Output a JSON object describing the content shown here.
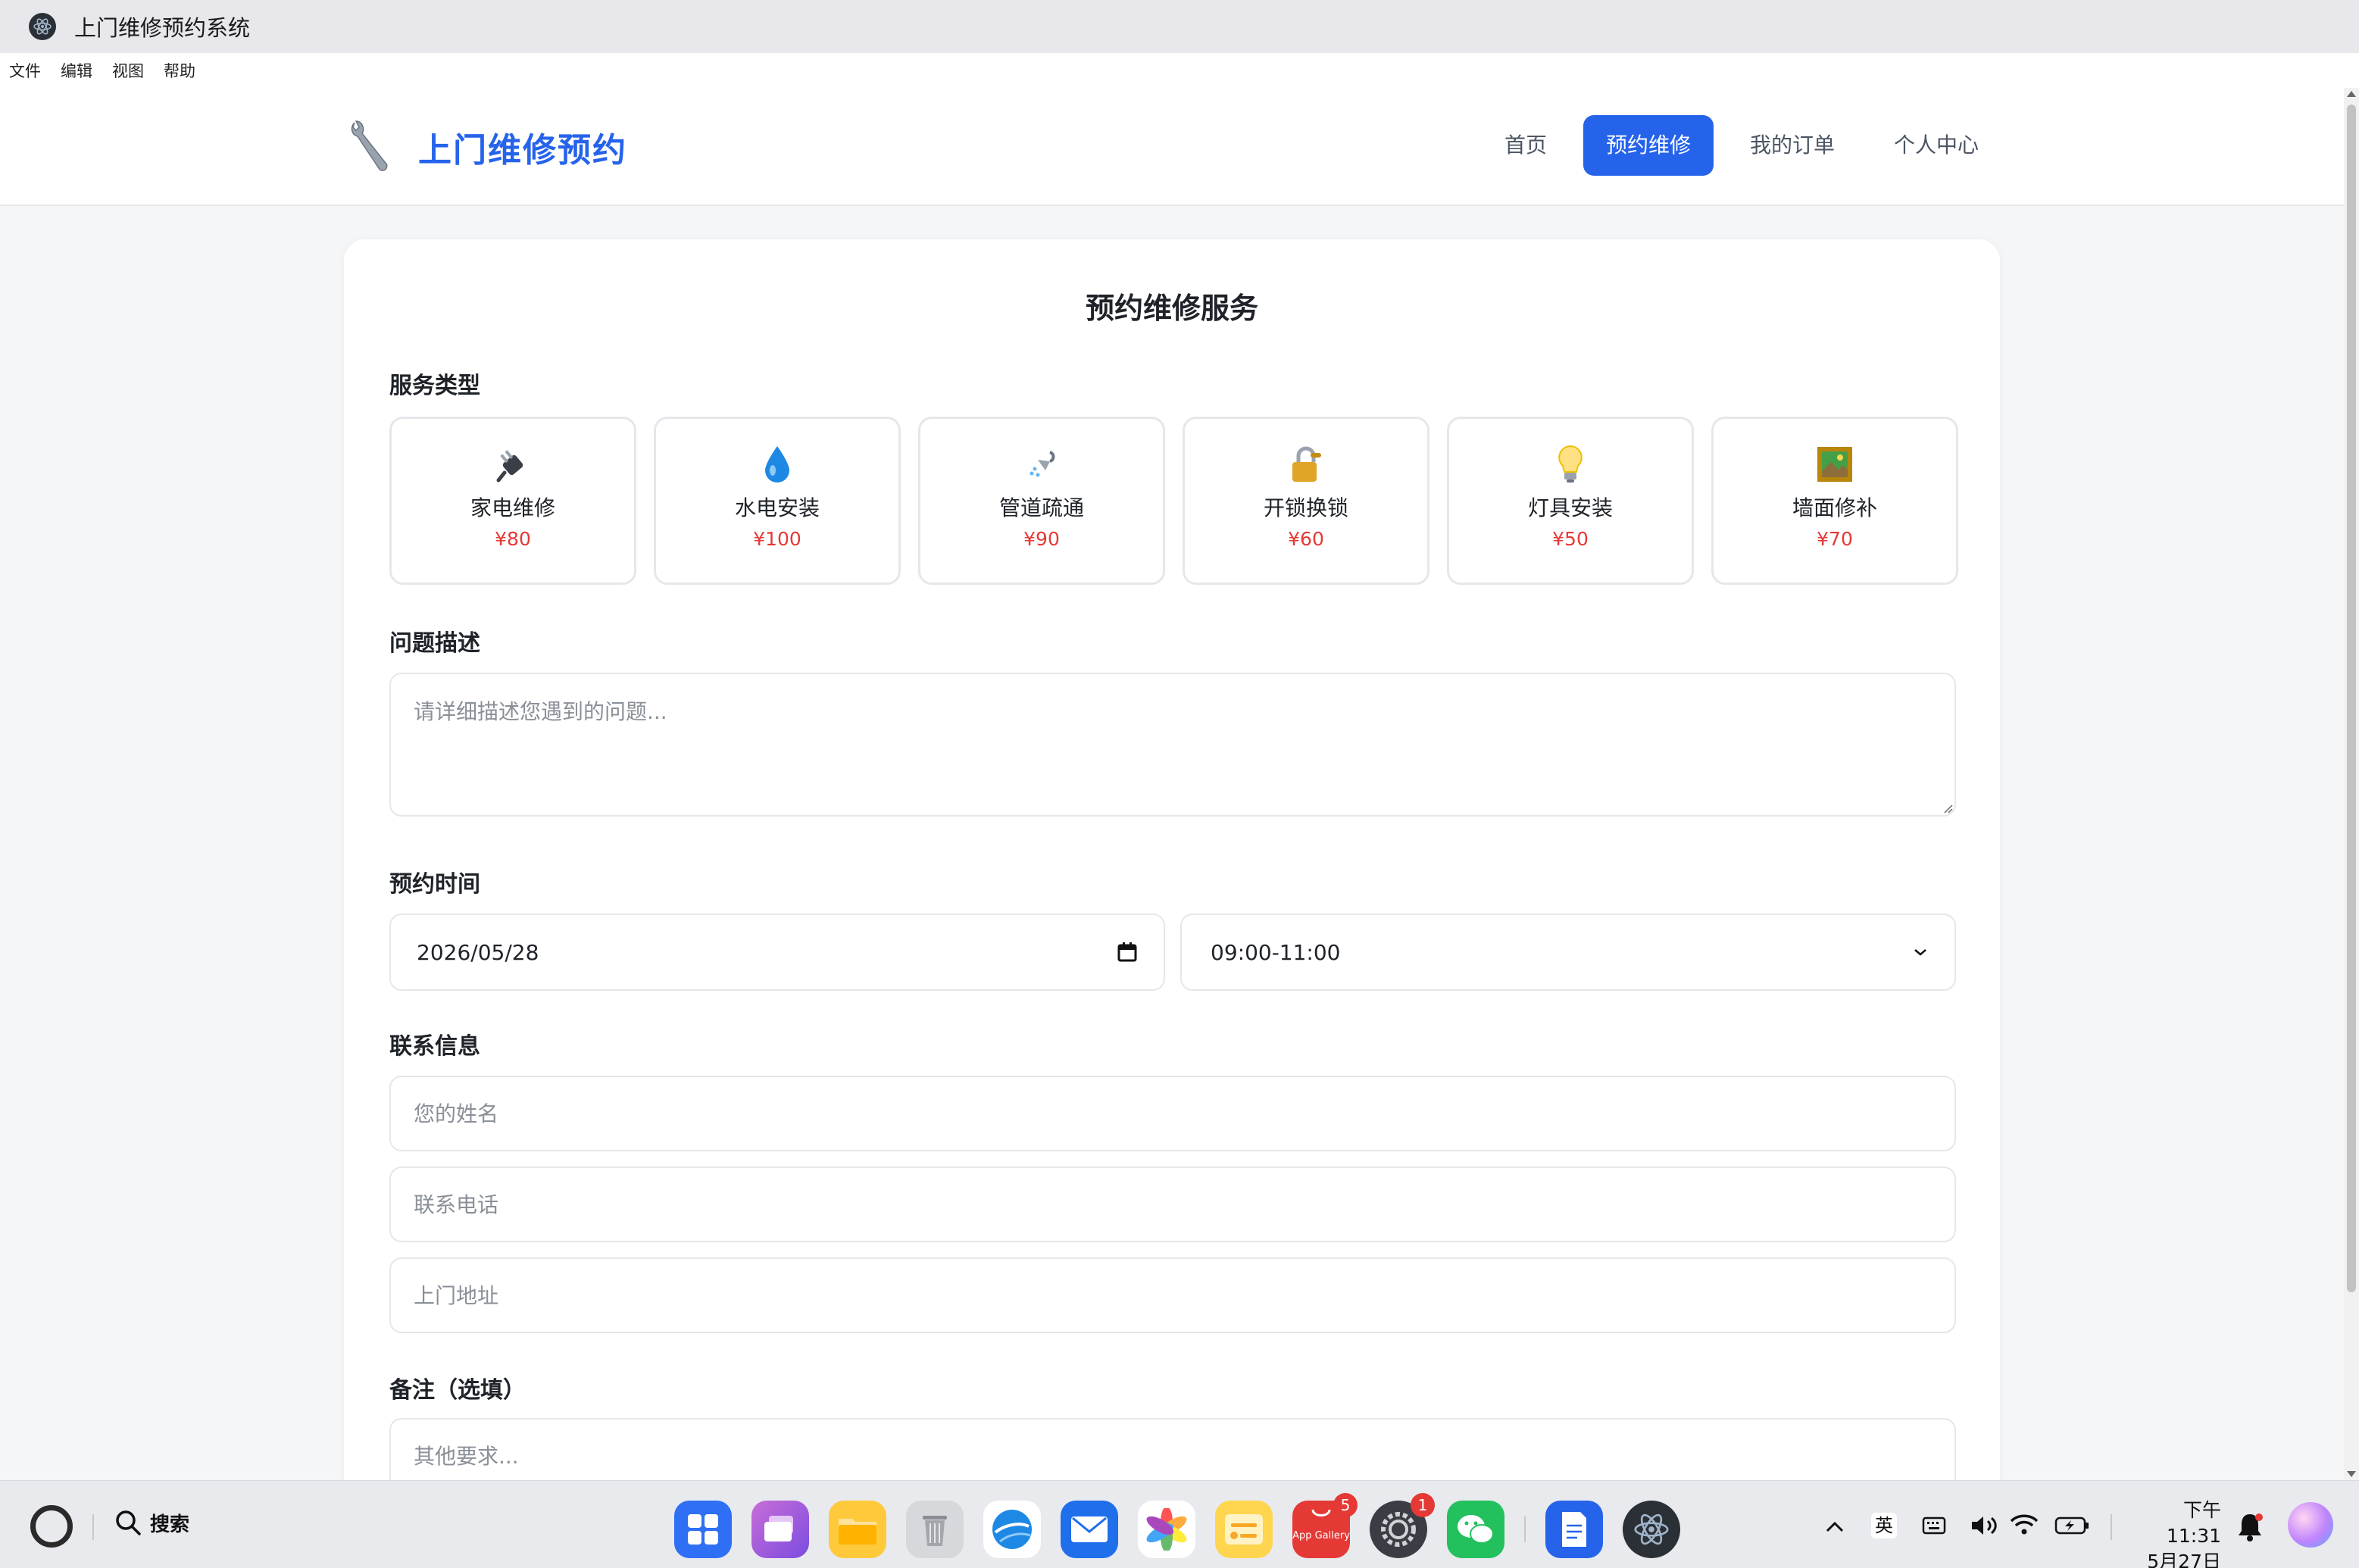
{
  "window": {
    "title": "上门维修预约系统"
  },
  "menu": [
    "文件",
    "编辑",
    "视图",
    "帮助"
  ],
  "header": {
    "brand": "上门维修预约",
    "nav": [
      {
        "label": "首页",
        "active": false
      },
      {
        "label": "预约维修",
        "active": true
      },
      {
        "label": "我的订单",
        "active": false
      },
      {
        "label": "个人中心",
        "active": false
      }
    ]
  },
  "form": {
    "title": "预约维修服务",
    "service_label": "服务类型",
    "services": [
      {
        "name": "家电维修",
        "price": "¥80",
        "icon": "plug-icon"
      },
      {
        "name": "水电安装",
        "price": "¥100",
        "icon": "water-drop-icon"
      },
      {
        "name": "管道疏通",
        "price": "¥90",
        "icon": "shower-icon"
      },
      {
        "name": "开锁换锁",
        "price": "¥60",
        "icon": "lock-key-icon"
      },
      {
        "name": "灯具安装",
        "price": "¥50",
        "icon": "light-bulb-icon"
      },
      {
        "name": "墙面修补",
        "price": "¥70",
        "icon": "framed-picture-icon"
      }
    ],
    "problem_label": "问题描述",
    "problem_placeholder": "请详细描述您遇到的问题...",
    "time_label": "预约时间",
    "date_value": "2026/05/28",
    "slot_value": "09:00-11:00",
    "contact_label": "联系信息",
    "name_placeholder": "您的姓名",
    "phone_placeholder": "联系电话",
    "address_placeholder": "上门地址",
    "remark_label": "备注（选填）",
    "remark_placeholder": "其他要求..."
  },
  "taskbar": {
    "search_label": "搜索",
    "apps": [
      {
        "name": "launcher",
        "badge": ""
      },
      {
        "name": "multitask",
        "badge": ""
      },
      {
        "name": "files",
        "badge": ""
      },
      {
        "name": "trash",
        "badge": ""
      },
      {
        "name": "browser",
        "badge": ""
      },
      {
        "name": "mail",
        "badge": ""
      },
      {
        "name": "photos",
        "badge": ""
      },
      {
        "name": "notes",
        "badge": ""
      },
      {
        "name": "app-gallery",
        "badge": "5",
        "label": "App Gallery"
      },
      {
        "name": "settings",
        "badge": "1"
      },
      {
        "name": "wechat",
        "badge": ""
      },
      {
        "name": "docs",
        "badge": ""
      },
      {
        "name": "electron-app",
        "badge": ""
      }
    ],
    "ime": "英",
    "time": "下午11:31",
    "date": "5月27日"
  },
  "colors": {
    "accent": "#2563eb",
    "price": "#e53935"
  }
}
